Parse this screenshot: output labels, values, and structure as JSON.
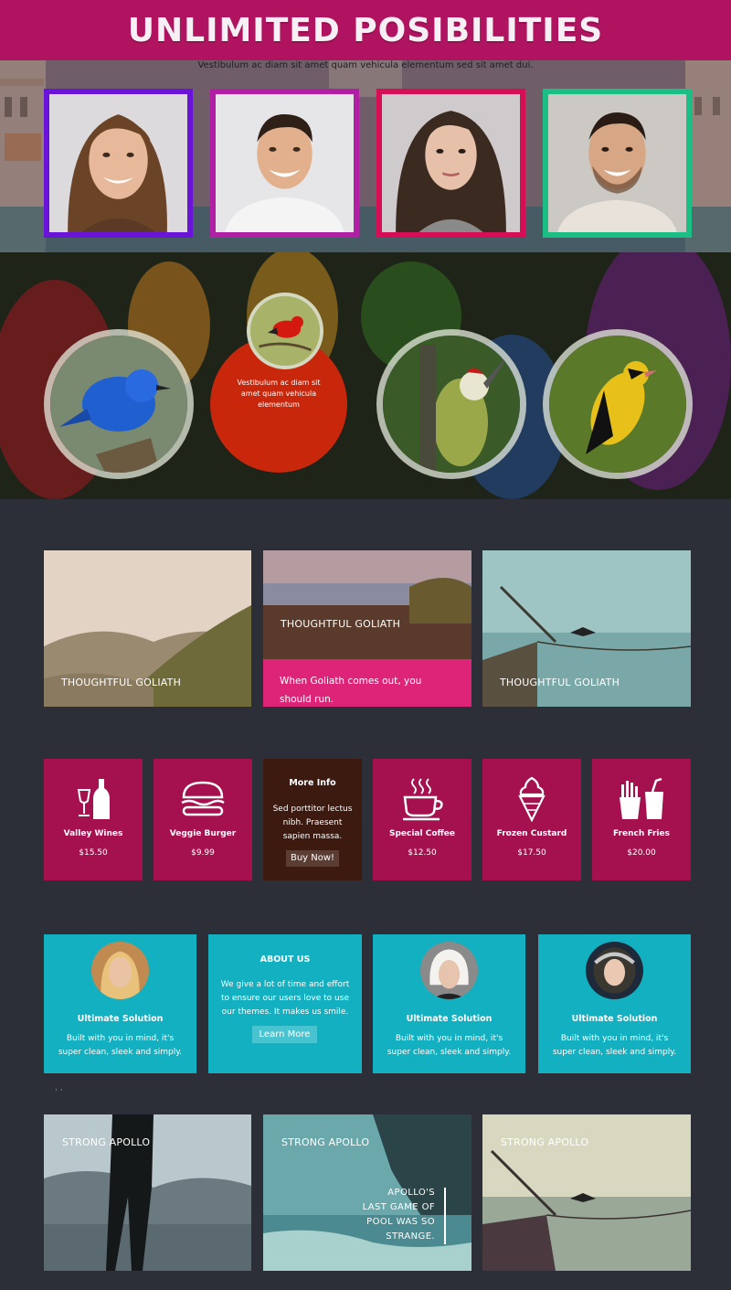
{
  "header": {
    "title": "UNLIMITED POSIBILITIES"
  },
  "team": {
    "subtitle": "Vestibulum ac diam sit amet quam vehicula elementum sed sit amet dui.",
    "members": [
      {
        "name": "woman-1",
        "border": "#6a14d9"
      },
      {
        "name": "man-1",
        "border": "#b11fa4"
      },
      {
        "name": "woman-2",
        "border": "#d60e56"
      },
      {
        "name": "man-2",
        "border": "#1bbf86"
      }
    ]
  },
  "birds": {
    "caption": "Vestibulum ac diam sit amet quam vehicula elementum"
  },
  "gallery": {
    "tiles": [
      {
        "caption": "THOUGHTFUL GOLIATH"
      },
      {
        "caption": "THOUGHTFUL GOLIATH",
        "overlay": "When Goliath comes out, you should run."
      },
      {
        "caption": "THOUGHTFUL GOLIATH"
      }
    ]
  },
  "menu": {
    "items": [
      {
        "name": "Valley Wines",
        "price": "$15.50",
        "icon": "wine-icon"
      },
      {
        "name": "Veggie Burger",
        "price": "$9.99",
        "icon": "burger-icon"
      },
      {
        "name": "Special Coffee",
        "price": "$12.50",
        "icon": "coffee-icon"
      },
      {
        "name": "Frozen Custard",
        "price": "$17.50",
        "icon": "ice-cream-icon"
      },
      {
        "name": "French Fries",
        "price": "$20.00",
        "icon": "fries-icon"
      }
    ],
    "more_info": {
      "title": "More Info",
      "text": "Sed porttitor lectus nibh. Praesent sapien massa.",
      "button": "Buy Now!"
    }
  },
  "features": {
    "cards": [
      {
        "title": "Ultimate Solution",
        "text": "Built with you in mind, it's super clean, sleek and simply."
      },
      {
        "title": "Ultimate Solution",
        "text": "Built with you in mind, it's super clean, sleek and simply."
      },
      {
        "title": "Ultimate Solution",
        "text": "Built with you in mind, it's super clean, sleek and simply."
      }
    ],
    "about": {
      "title": "ABOUT US",
      "text": "We give a lot of time and effort to ensure our users love to use our themes. It makes us smile.",
      "button": "Learn More"
    }
  },
  "apollo": {
    "tiles": [
      {
        "caption": "STRONG APOLLO"
      },
      {
        "caption": "STRONG APOLLO",
        "quote": "APOLLO'S LAST GAME OF POOL WAS SO STRANGE."
      },
      {
        "caption": "STRONG APOLLO"
      }
    ]
  },
  "colors": {
    "header": "#b0135f",
    "menu_tile": "#a5104f",
    "feature_tile": "#12b0c0",
    "page_bg": "#2d2f38"
  }
}
